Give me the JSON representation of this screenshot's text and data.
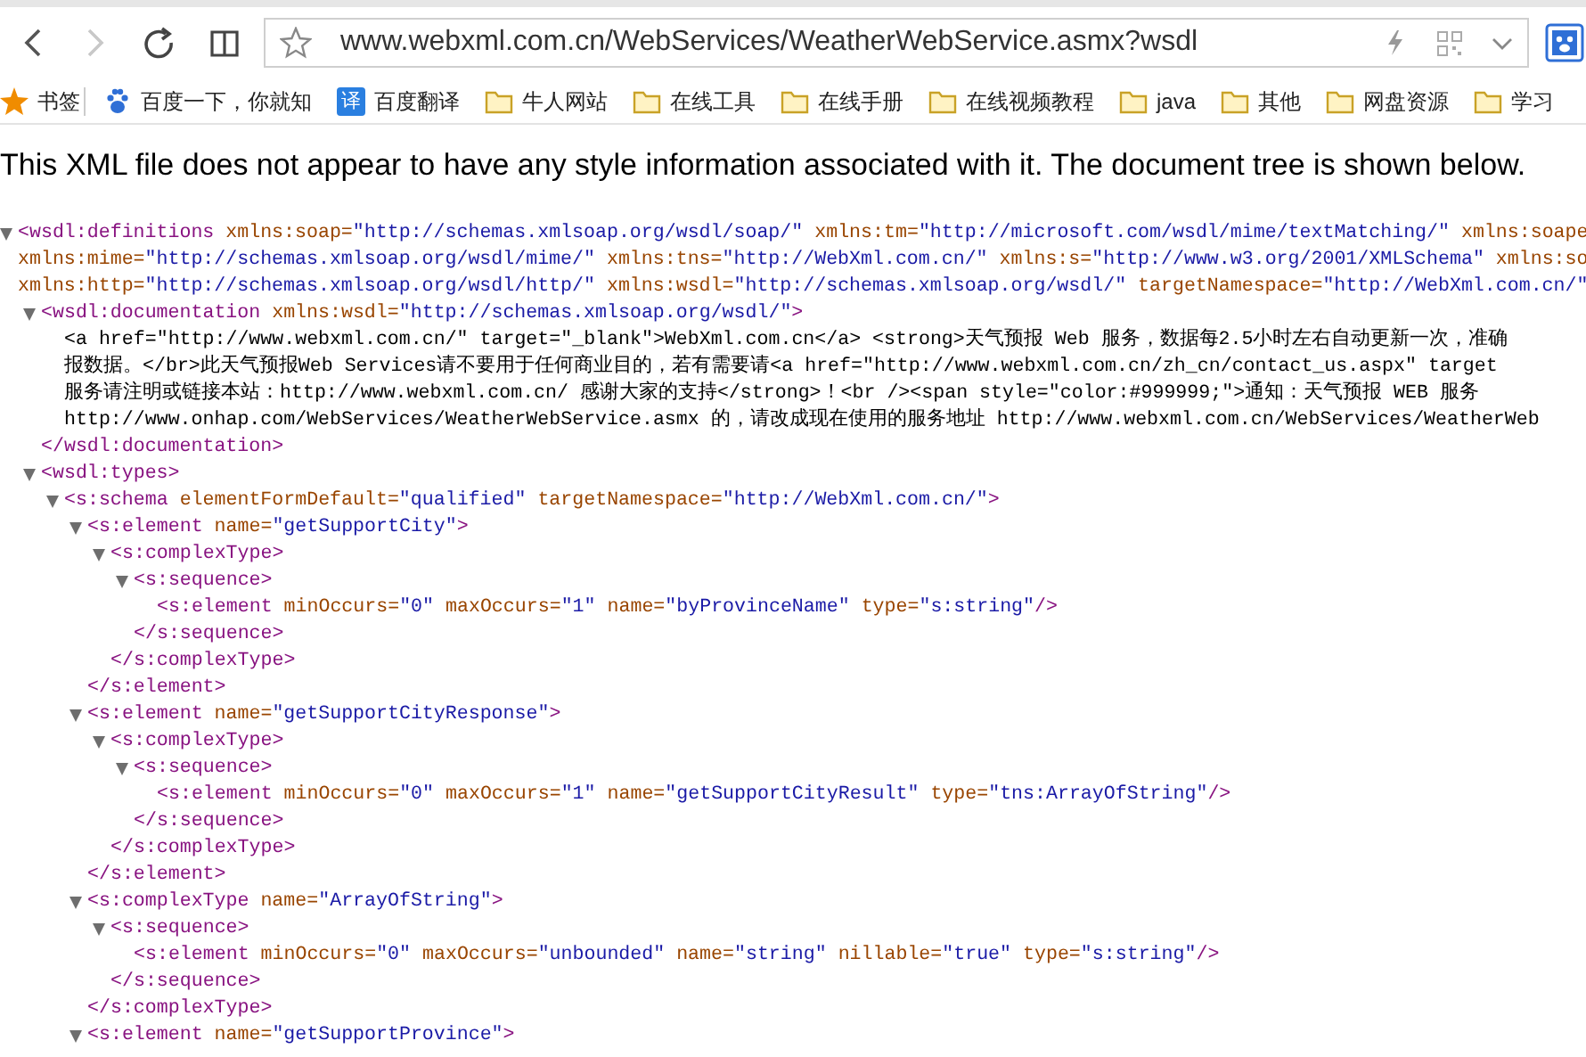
{
  "toolbar": {
    "back": {
      "disabled": false
    },
    "forward": {
      "disabled": true
    },
    "address": {
      "url": "www.webxml.com.cn/WebServices/WeatherWebService.asmx?wsdl"
    }
  },
  "bookmarks": [
    {
      "kind": "star",
      "label": "书签"
    },
    {
      "kind": "paw",
      "label": "百度一下，你就知"
    },
    {
      "kind": "badge",
      "badge_text": "译",
      "label": "百度翻译"
    },
    {
      "kind": "folder",
      "label": "牛人网站"
    },
    {
      "kind": "folder",
      "label": "在线工具"
    },
    {
      "kind": "folder",
      "label": "在线手册"
    },
    {
      "kind": "folder",
      "label": "在线视频教程"
    },
    {
      "kind": "folder",
      "label": "java"
    },
    {
      "kind": "folder",
      "label": "其他"
    },
    {
      "kind": "folder",
      "label": "网盘资源"
    },
    {
      "kind": "folder",
      "label": "学习"
    }
  ],
  "notice": "This XML file does not appear to have any style information associated with it. The document tree is shown below.",
  "xml_tree": [
    {
      "kind": "element",
      "expanded": true,
      "open_lines": [
        [
          {
            "kind": "tag",
            "text": "<wsdl:definitions"
          },
          {
            "kind": "attr",
            "text": "xmlns:soap="
          },
          {
            "kind": "value",
            "text": "\"http://schemas.xmlsoap.org/wsdl/soap/\""
          },
          {
            "kind": "attr",
            "text": "xmlns:tm="
          },
          {
            "kind": "value",
            "text": "\"http://microsoft.com/wsdl/mime/textMatching/\""
          },
          {
            "kind": "attr",
            "text": "xmlns:soape"
          }
        ],
        [
          {
            "kind": "attr",
            "text": "xmlns:mime="
          },
          {
            "kind": "value",
            "text": "\"http://schemas.xmlsoap.org/wsdl/mime/\""
          },
          {
            "kind": "attr",
            "text": "xmlns:tns="
          },
          {
            "kind": "value",
            "text": "\"http://WebXml.com.cn/\""
          },
          {
            "kind": "attr",
            "text": "xmlns:s="
          },
          {
            "kind": "value",
            "text": "\"http://www.w3.org/2001/XMLSchema\""
          },
          {
            "kind": "attr",
            "text": "xmlns:so"
          }
        ],
        [
          {
            "kind": "attr",
            "text": "xmlns:http="
          },
          {
            "kind": "value",
            "text": "\"http://schemas.xmlsoap.org/wsdl/http/\""
          },
          {
            "kind": "attr",
            "text": "xmlns:wsdl="
          },
          {
            "kind": "value",
            "text": "\"http://schemas.xmlsoap.org/wsdl/\""
          },
          {
            "kind": "attr",
            "text": "targetNamespace="
          },
          {
            "kind": "value",
            "text": "\"http://WebXml.com.cn/\""
          }
        ]
      ],
      "children": [
        {
          "kind": "element",
          "expanded": true,
          "open_lines": [
            [
              {
                "kind": "tag",
                "text": "<wsdl:documentation"
              },
              {
                "kind": "attr",
                "text": "xmlns:wsdl="
              },
              {
                "kind": "value",
                "text": "\"http://schemas.xmlsoap.org/wsdl/\""
              },
              {
                "kind": "tag",
                "text": ">"
              }
            ]
          ],
          "children": [
            {
              "kind": "text",
              "lines": [
                "<a href=\"http://www.webxml.com.cn/\" target=\"_blank\">WebXml.com.cn</a> <strong>天气预报 Web 服务，数据每2.5小时左右自动更新一次，准确",
                "报数据。</br>此天气预报Web Services请不要用于任何商业目的，若有需要请<a href=\"http://www.webxml.com.cn/zh_cn/contact_us.aspx\" target",
                "服务请注明或链接本站：http://www.webxml.com.cn/ 感谢大家的支持</strong>！<br /><span style=\"color:#999999;\">通知：天气预报 WEB 服务",
                "http://www.onhap.com/WebServices/WeatherWebService.asmx 的，请改成现在使用的服务地址 http://www.webxml.com.cn/WebServices/WeatherWeb"
              ]
            }
          ],
          "close": [
            {
              "kind": "tag",
              "text": "</wsdl:documentation>"
            }
          ]
        },
        {
          "kind": "element",
          "expanded": true,
          "open_lines": [
            [
              {
                "kind": "tag",
                "text": "<wsdl:types>"
              }
            ]
          ],
          "children": [
            {
              "kind": "element",
              "expanded": true,
              "open_lines": [
                [
                  {
                    "kind": "tag",
                    "text": "<s:schema"
                  },
                  {
                    "kind": "attr",
                    "text": "elementFormDefault="
                  },
                  {
                    "kind": "value",
                    "text": "\"qualified\""
                  },
                  {
                    "kind": "attr",
                    "text": "targetNamespace="
                  },
                  {
                    "kind": "value",
                    "text": "\"http://WebXml.com.cn/\""
                  },
                  {
                    "kind": "tag",
                    "text": ">"
                  }
                ]
              ],
              "children": [
                {
                  "kind": "element",
                  "expanded": true,
                  "open_lines": [
                    [
                      {
                        "kind": "tag",
                        "text": "<s:element"
                      },
                      {
                        "kind": "attr",
                        "text": "name="
                      },
                      {
                        "kind": "value",
                        "text": "\"getSupportCity\""
                      },
                      {
                        "kind": "tag",
                        "text": ">"
                      }
                    ]
                  ],
                  "children": [
                    {
                      "kind": "element",
                      "expanded": true,
                      "open_lines": [
                        [
                          {
                            "kind": "tag",
                            "text": "<s:complexType>"
                          }
                        ]
                      ],
                      "children": [
                        {
                          "kind": "element",
                          "expanded": true,
                          "open_lines": [
                            [
                              {
                                "kind": "tag",
                                "text": "<s:sequence>"
                              }
                            ]
                          ],
                          "children": [
                            {
                              "kind": "element",
                              "open_lines": [
                                [
                                  {
                                    "kind": "tag",
                                    "text": "<s:element"
                                  },
                                  {
                                    "kind": "attr",
                                    "text": "minOccurs="
                                  },
                                  {
                                    "kind": "value",
                                    "text": "\"0\""
                                  },
                                  {
                                    "kind": "attr",
                                    "text": "maxOccurs="
                                  },
                                  {
                                    "kind": "value",
                                    "text": "\"1\""
                                  },
                                  {
                                    "kind": "attr",
                                    "text": "name="
                                  },
                                  {
                                    "kind": "value",
                                    "text": "\"byProvinceName\""
                                  },
                                  {
                                    "kind": "attr",
                                    "text": "type="
                                  },
                                  {
                                    "kind": "value",
                                    "text": "\"s:string\""
                                  },
                                  {
                                    "kind": "tag",
                                    "text": "/>"
                                  }
                                ]
                              ]
                            }
                          ],
                          "close": [
                            {
                              "kind": "tag",
                              "text": "</s:sequence>"
                            }
                          ]
                        }
                      ],
                      "close": [
                        {
                          "kind": "tag",
                          "text": "</s:complexType>"
                        }
                      ]
                    }
                  ],
                  "close": [
                    {
                      "kind": "tag",
                      "text": "</s:element>"
                    }
                  ]
                },
                {
                  "kind": "element",
                  "expanded": true,
                  "open_lines": [
                    [
                      {
                        "kind": "tag",
                        "text": "<s:element"
                      },
                      {
                        "kind": "attr",
                        "text": "name="
                      },
                      {
                        "kind": "value",
                        "text": "\"getSupportCityResponse\""
                      },
                      {
                        "kind": "tag",
                        "text": ">"
                      }
                    ]
                  ],
                  "children": [
                    {
                      "kind": "element",
                      "expanded": true,
                      "open_lines": [
                        [
                          {
                            "kind": "tag",
                            "text": "<s:complexType>"
                          }
                        ]
                      ],
                      "children": [
                        {
                          "kind": "element",
                          "expanded": true,
                          "open_lines": [
                            [
                              {
                                "kind": "tag",
                                "text": "<s:sequence>"
                              }
                            ]
                          ],
                          "children": [
                            {
                              "kind": "element",
                              "open_lines": [
                                [
                                  {
                                    "kind": "tag",
                                    "text": "<s:element"
                                  },
                                  {
                                    "kind": "attr",
                                    "text": "minOccurs="
                                  },
                                  {
                                    "kind": "value",
                                    "text": "\"0\""
                                  },
                                  {
                                    "kind": "attr",
                                    "text": "maxOccurs="
                                  },
                                  {
                                    "kind": "value",
                                    "text": "\"1\""
                                  },
                                  {
                                    "kind": "attr",
                                    "text": "name="
                                  },
                                  {
                                    "kind": "value",
                                    "text": "\"getSupportCityResult\""
                                  },
                                  {
                                    "kind": "attr",
                                    "text": "type="
                                  },
                                  {
                                    "kind": "value",
                                    "text": "\"tns:ArrayOfString\""
                                  },
                                  {
                                    "kind": "tag",
                                    "text": "/>"
                                  }
                                ]
                              ]
                            }
                          ],
                          "close": [
                            {
                              "kind": "tag",
                              "text": "</s:sequence>"
                            }
                          ]
                        }
                      ],
                      "close": [
                        {
                          "kind": "tag",
                          "text": "</s:complexType>"
                        }
                      ]
                    }
                  ],
                  "close": [
                    {
                      "kind": "tag",
                      "text": "</s:element>"
                    }
                  ]
                },
                {
                  "kind": "element",
                  "expanded": true,
                  "open_lines": [
                    [
                      {
                        "kind": "tag",
                        "text": "<s:complexType"
                      },
                      {
                        "kind": "attr",
                        "text": "name="
                      },
                      {
                        "kind": "value",
                        "text": "\"ArrayOfString\""
                      },
                      {
                        "kind": "tag",
                        "text": ">"
                      }
                    ]
                  ],
                  "children": [
                    {
                      "kind": "element",
                      "expanded": true,
                      "open_lines": [
                        [
                          {
                            "kind": "tag",
                            "text": "<s:sequence>"
                          }
                        ]
                      ],
                      "children": [
                        {
                          "kind": "element",
                          "open_lines": [
                            [
                              {
                                "kind": "tag",
                                "text": "<s:element"
                              },
                              {
                                "kind": "attr",
                                "text": "minOccurs="
                              },
                              {
                                "kind": "value",
                                "text": "\"0\""
                              },
                              {
                                "kind": "attr",
                                "text": "maxOccurs="
                              },
                              {
                                "kind": "value",
                                "text": "\"unbounded\""
                              },
                              {
                                "kind": "attr",
                                "text": "name="
                              },
                              {
                                "kind": "value",
                                "text": "\"string\""
                              },
                              {
                                "kind": "attr",
                                "text": "nillable="
                              },
                              {
                                "kind": "value",
                                "text": "\"true\""
                              },
                              {
                                "kind": "attr",
                                "text": "type="
                              },
                              {
                                "kind": "value",
                                "text": "\"s:string\""
                              },
                              {
                                "kind": "tag",
                                "text": "/>"
                              }
                            ]
                          ]
                        }
                      ],
                      "close": [
                        {
                          "kind": "tag",
                          "text": "</s:sequence>"
                        }
                      ]
                    }
                  ],
                  "close": [
                    {
                      "kind": "tag",
                      "text": "</s:complexType>"
                    }
                  ]
                },
                {
                  "kind": "element",
                  "expanded": true,
                  "open_lines": [
                    [
                      {
                        "kind": "tag",
                        "text": "<s:element"
                      },
                      {
                        "kind": "attr",
                        "text": "name="
                      },
                      {
                        "kind": "value",
                        "text": "\"getSupportProvince\""
                      },
                      {
                        "kind": "tag",
                        "text": ">"
                      }
                    ]
                  ]
                }
              ]
            }
          ]
        }
      ]
    }
  ]
}
